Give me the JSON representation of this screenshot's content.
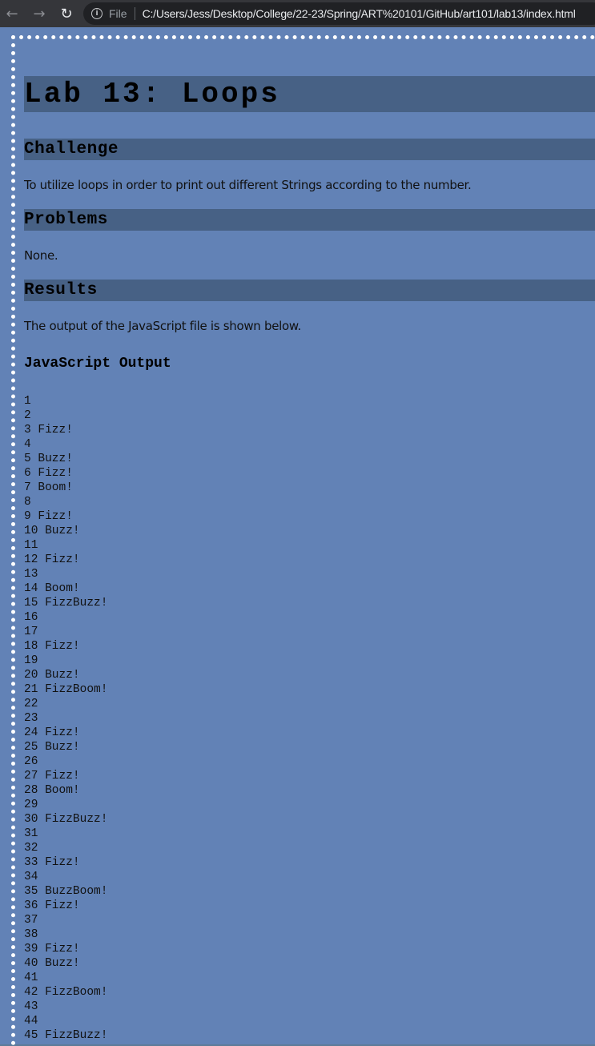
{
  "browser": {
    "scheme_label": "File",
    "url": "C:/Users/Jess/Desktop/College/22-23/Spring/ART%20101/GitHub/art101/lab13/index.html"
  },
  "page": {
    "title": "Lab 13: Loops",
    "challenge_heading": "Challenge",
    "challenge_text": "To utilize loops in order to print out different Strings according to the number.",
    "problems_heading": "Problems",
    "problems_text": "None.",
    "results_heading": "Results",
    "results_text": "The output of the JavaScript file is shown below.",
    "output_heading": "JavaScript Output",
    "output_lines": [
      "1",
      "2",
      "3 Fizz!",
      "4",
      "5 Buzz!",
      "6 Fizz!",
      "7 Boom!",
      "8",
      "9 Fizz!",
      "10 Buzz!",
      "11",
      "12 Fizz!",
      "13",
      "14 Boom!",
      "15 FizzBuzz!",
      "16",
      "17",
      "18 Fizz!",
      "19",
      "20 Buzz!",
      "21 FizzBoom!",
      "22",
      "23",
      "24 Fizz!",
      "25 Buzz!",
      "26",
      "27 Fizz!",
      "28 Boom!",
      "29",
      "30 FizzBuzz!",
      "31",
      "32",
      "33 Fizz!",
      "34",
      "35 BuzzBoom!",
      "36 Fizz!",
      "37",
      "38",
      "39 Fizz!",
      "40 Buzz!",
      "41",
      "42 FizzBoom!",
      "43",
      "44",
      "45 FizzBuzz!"
    ]
  },
  "colors": {
    "page_background": "#6282b6",
    "heading_band": "#476185",
    "outer_border": "#5d7b98",
    "dotted_frame": "#ffffff"
  },
  "icons": {
    "back": "arrow-left-icon",
    "forward": "arrow-right-icon",
    "reload": "reload-icon",
    "info": "info-icon"
  }
}
